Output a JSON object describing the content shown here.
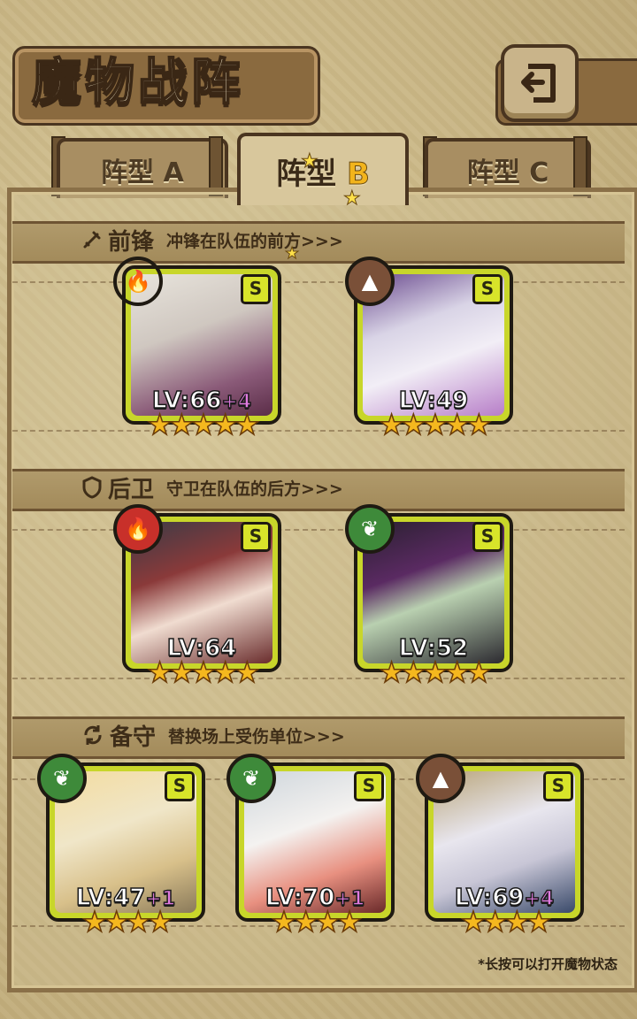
{
  "title": "魔物战阵",
  "tabs": [
    {
      "prefix": "阵型",
      "suffix": "A",
      "active": false
    },
    {
      "prefix": "阵型",
      "suffix": "B",
      "active": true
    },
    {
      "prefix": "阵型",
      "suffix": "C",
      "active": false
    }
  ],
  "sections": {
    "front": {
      "name": "前锋",
      "desc": "冲锋在队伍的前方>>>",
      "icon": "sword-icon"
    },
    "back": {
      "name": "后卫",
      "desc": "守卫在队伍的后方>>>",
      "icon": "shield-icon"
    },
    "reserve": {
      "name": "备守",
      "desc": "替换场上受伤单位>>>",
      "icon": "swap-icon"
    }
  },
  "units": {
    "front_1": {
      "element": "fire",
      "rank": "S",
      "level": "LV:66",
      "plus": "+4",
      "stars": 5
    },
    "front_2": {
      "element": "earth",
      "rank": "S",
      "level": "LV:49",
      "plus": "",
      "stars": 5
    },
    "back_1": {
      "element": "fire",
      "rank": "S",
      "level": "LV:64",
      "plus": "",
      "stars": 5
    },
    "back_2": {
      "element": "wood",
      "rank": "S",
      "level": "LV:52",
      "plus": "",
      "stars": 5
    },
    "reserve_1": {
      "element": "wood",
      "rank": "S",
      "level": "LV:47",
      "plus": "+1",
      "stars": 4
    },
    "reserve_2": {
      "element": "wood",
      "rank": "S",
      "level": "LV:70",
      "plus": "+1",
      "stars": 4
    },
    "reserve_3": {
      "element": "earth",
      "rank": "S",
      "level": "LV:69",
      "plus": "+4",
      "stars": 4
    }
  },
  "hint": "*长按可以打开魔物状态",
  "colors": {
    "card_frame": "#c8d62a",
    "fire": "#c8302a",
    "earth": "#7a5038",
    "wood": "#3e8a3a",
    "star": "#f5b81e"
  }
}
